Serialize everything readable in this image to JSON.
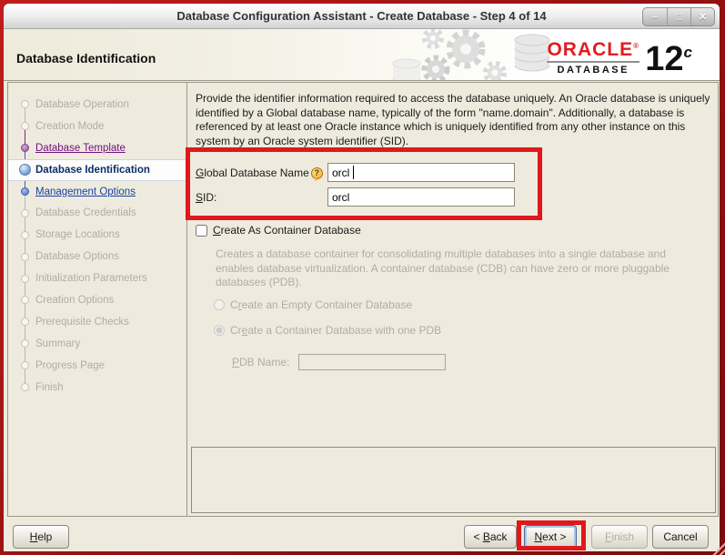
{
  "window": {
    "title": "Database Configuration Assistant - Create Database - Step 4 of 14",
    "controls": {
      "minimize": "–",
      "maximize": "□",
      "close": "✕"
    }
  },
  "header": {
    "title": "Database Identification",
    "logo": {
      "brand": "ORACLE",
      "registered": "®",
      "product": "DATABASE",
      "version": "12",
      "edition": "c"
    }
  },
  "sidebar": {
    "steps": [
      {
        "label": "Database Operation",
        "state": "pending"
      },
      {
        "label": "Creation Mode",
        "state": "pending"
      },
      {
        "label": "Database Template",
        "state": "visited"
      },
      {
        "label": "Database Identification",
        "state": "current"
      },
      {
        "label": "Management Options",
        "state": "link"
      },
      {
        "label": "Database Credentials",
        "state": "pending"
      },
      {
        "label": "Storage Locations",
        "state": "pending"
      },
      {
        "label": "Database Options",
        "state": "pending"
      },
      {
        "label": "Initialization Parameters",
        "state": "pending"
      },
      {
        "label": "Creation Options",
        "state": "pending"
      },
      {
        "label": "Prerequisite Checks",
        "state": "pending"
      },
      {
        "label": "Summary",
        "state": "pending"
      },
      {
        "label": "Progress Page",
        "state": "pending"
      },
      {
        "label": "Finish",
        "state": "pending"
      }
    ]
  },
  "content": {
    "description": "Provide the identifier information required to access the database uniquely. An Oracle database is uniquely identified by a Global database name, typically of the form \"name.domain\". Additionally, a database is referenced by at least one Oracle instance which is uniquely identified from any other instance on this system by an Oracle system identifier (SID).",
    "gdb": {
      "label_key": "G",
      "label_rest": "lobal Database Name",
      "help_icon": "?",
      "value": "orcl"
    },
    "sid": {
      "label_key": "S",
      "label_rest": "ID:",
      "value": "orcl"
    },
    "cdb": {
      "checkbox_key": "C",
      "checkbox_rest": "reate As Container Database",
      "info": "Creates a database container for consolidating multiple databases into a single database and enables database virtualization. A container database (CDB) can have zero or more pluggable databases (PDB).",
      "radio_empty": {
        "pre": "C",
        "key": "r",
        "post": "eate an Empty Container Database"
      },
      "radio_pdb": {
        "pre": "Cr",
        "key": "e",
        "post": "ate a Container Database with one PDB"
      },
      "pdb_label": {
        "key": "P",
        "post": "DB Name:"
      },
      "pdb_value": ""
    }
  },
  "footer": {
    "help": {
      "key": "H",
      "post": "elp"
    },
    "back": {
      "pre": "< ",
      "key": "B",
      "post": "ack"
    },
    "next": {
      "key": "N",
      "post": "ext >"
    },
    "finish": {
      "key": "F",
      "post": "inish"
    },
    "cancel": {
      "label": "Cancel"
    }
  },
  "colors": {
    "annotation_red": "#e0181c",
    "frame_red": "#8e1010",
    "oracle_red": "#e21c21",
    "panel_beige": "#eeebde"
  }
}
